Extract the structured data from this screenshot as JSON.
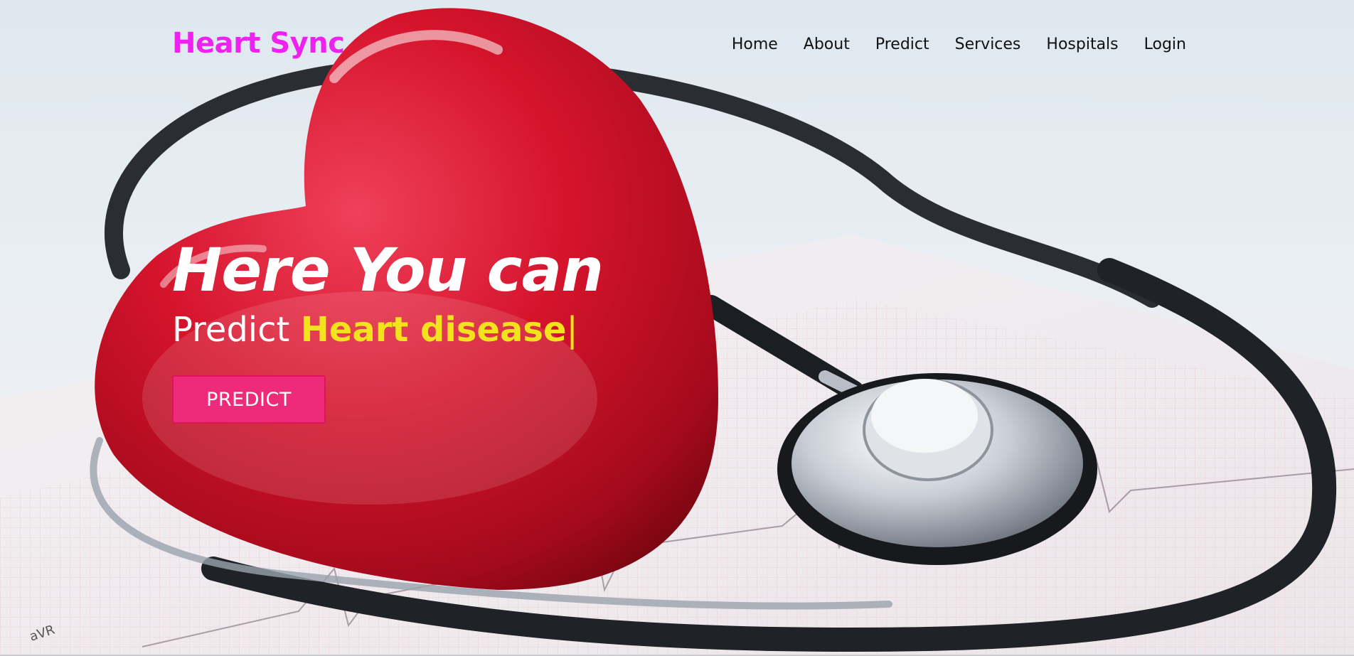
{
  "brand": {
    "name": "Heart Sync",
    "color": "#ee22ee"
  },
  "nav": {
    "items": [
      {
        "label": "Home"
      },
      {
        "label": "About"
      },
      {
        "label": "Predict"
      },
      {
        "label": "Services"
      },
      {
        "label": "Hospitals"
      },
      {
        "label": "Login"
      }
    ]
  },
  "hero": {
    "title": "Here You can",
    "subtitle_prefix": "Predict ",
    "subtitle_highlight": "Heart disease",
    "caret": "|",
    "highlight_color": "#f2e31c",
    "cta_label": "PREDICT",
    "cta_color": "#ee2a7b"
  },
  "background": {
    "icons": [
      "heart-icon",
      "stethoscope-icon",
      "ecg-paper-icon"
    ],
    "ecg_lead_label": "aVR"
  }
}
